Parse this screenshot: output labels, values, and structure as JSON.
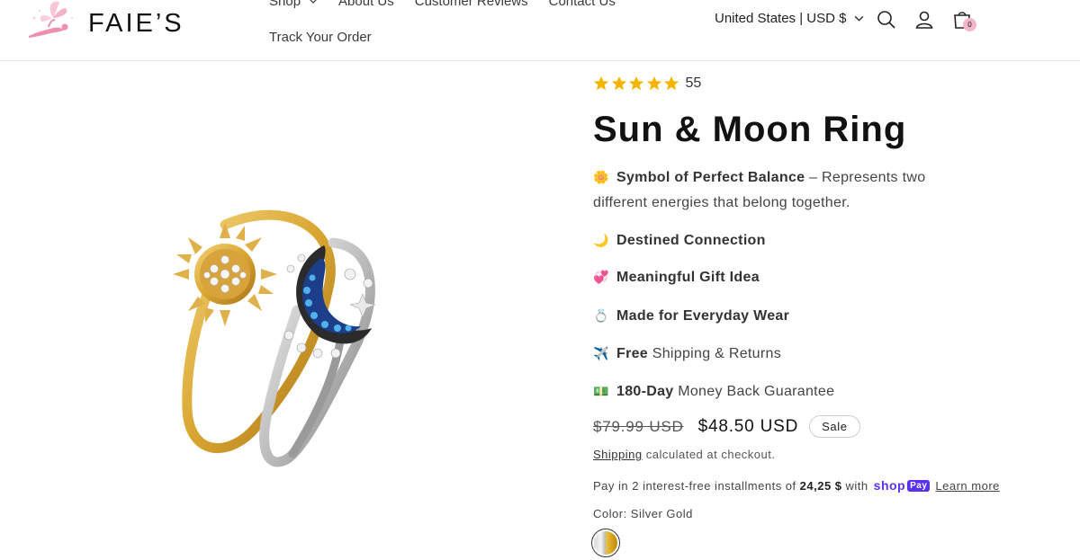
{
  "header": {
    "logo_text": "FAIE’S",
    "nav": {
      "items": [
        {
          "label": "Shop",
          "has_dropdown": true
        },
        {
          "label": "About Us"
        },
        {
          "label": "Customer Reviews"
        },
        {
          "label": "Contact Us"
        }
      ],
      "second_row": "Track Your Order"
    },
    "locale": "United States | USD $",
    "cart_count": "0"
  },
  "product": {
    "rating_count": "55",
    "stars": 5,
    "title": "Sun & Moon Ring",
    "features": [
      {
        "emoji": "🌼",
        "bold": "Symbol of Perfect Balance",
        "rest": " – Represents two different energies that belong together."
      },
      {
        "emoji": "🌙",
        "bold": "Destined Connection",
        "rest": ""
      },
      {
        "emoji": "💞",
        "bold": "Meaningful Gift Idea",
        "rest": ""
      },
      {
        "emoji": "💍",
        "bold": "Made for Everyday Wear",
        "rest": ""
      },
      {
        "emoji": "✈️",
        "bold": "Free",
        "rest": " Shipping & Returns"
      },
      {
        "emoji": "💵",
        "bold": "180-Day",
        "rest": " Money Back Guarantee"
      }
    ],
    "compare_price": "$79.99 USD",
    "sale_price": "$48.50 USD",
    "sale_badge": "Sale",
    "shipping_link": "Shipping",
    "shipping_rest": "calculated at checkout.",
    "installments_text": "Pay in 2 interest-free installments of",
    "installments_amount": "24,25 $",
    "installments_with": "with",
    "shoppay_shop": "shop",
    "shoppay_pay": "Pay",
    "learn_more": "Learn more",
    "color_label": "Color: Silver Gold"
  },
  "colors": {
    "star": "#f5b400",
    "accent_pink": "#f2b6c8",
    "shoppay": "#5a31f4"
  }
}
